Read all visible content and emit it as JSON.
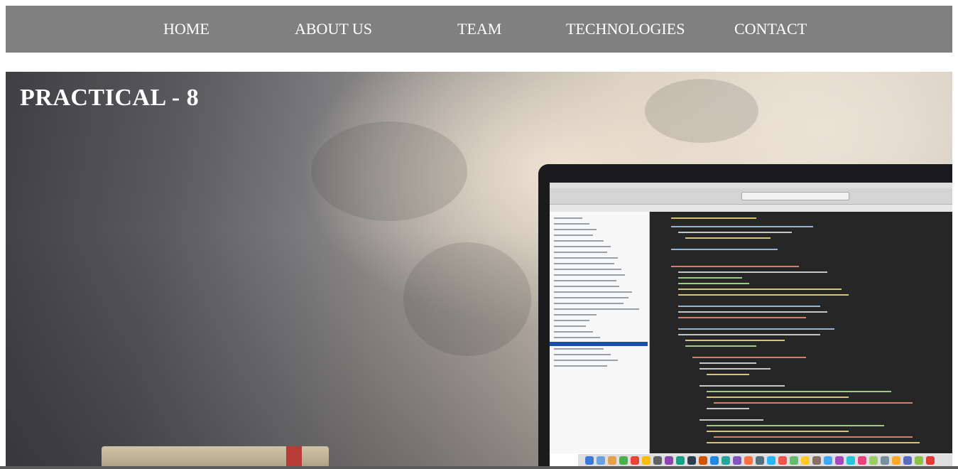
{
  "nav": {
    "items": [
      {
        "label": "HOME"
      },
      {
        "label": "ABOUT US"
      },
      {
        "label": "TEAM"
      },
      {
        "label": "TECHNOLOGIES"
      },
      {
        "label": "CONTACT"
      }
    ]
  },
  "hero": {
    "title": "PRACTICAL - 8"
  },
  "colors": {
    "navbar_bg": "#808080",
    "nav_text": "#ffffff",
    "hero_title": "#ffffff"
  },
  "icons": [
    "laptop-photo"
  ]
}
